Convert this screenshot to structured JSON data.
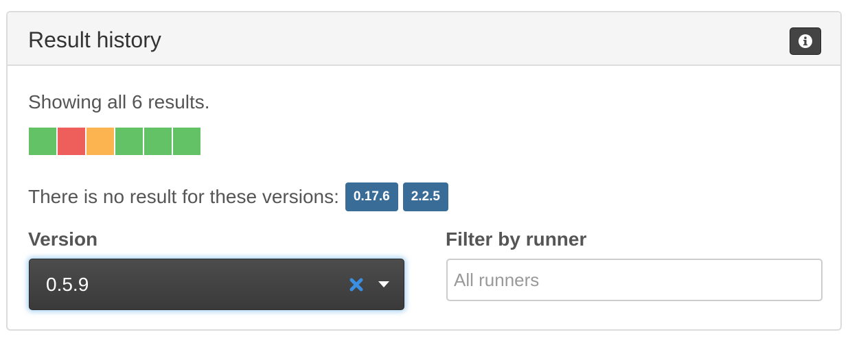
{
  "panel": {
    "title": "Result history",
    "info_icon": "info-circle-icon"
  },
  "summary": {
    "text": "Showing all 6 results."
  },
  "results": [
    {
      "status": "pass",
      "color": "#63c265"
    },
    {
      "status": "fail",
      "color": "#ee5f5b"
    },
    {
      "status": "warning",
      "color": "#fbb450"
    },
    {
      "status": "pass",
      "color": "#63c265"
    },
    {
      "status": "pass",
      "color": "#63c265"
    },
    {
      "status": "pass",
      "color": "#63c265"
    }
  ],
  "missing": {
    "text": "There is no result for these versions:",
    "versions": [
      "0.17.6",
      "2.2.5"
    ]
  },
  "version_filter": {
    "label": "Version",
    "selected": "0.5.9",
    "clear_icon": "clear-x-icon",
    "dropdown_icon": "chevron-down-icon"
  },
  "runner_filter": {
    "label": "Filter by runner",
    "placeholder": "All runners",
    "value": ""
  },
  "colors": {
    "tag": "#3a6c98",
    "clear_icon": "#3b8fe0",
    "select_bg": "#444444"
  }
}
